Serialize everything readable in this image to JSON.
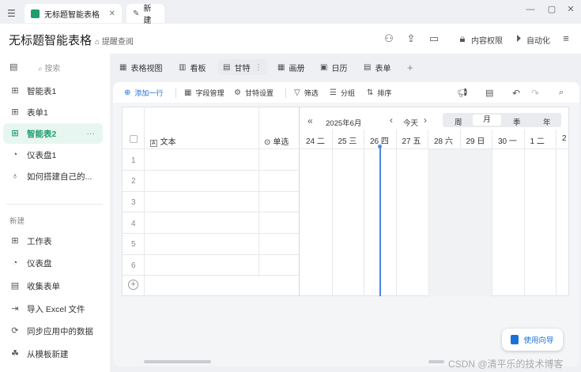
{
  "titlebar": {
    "tabs": [
      {
        "label": "无标题智能表格"
      },
      {
        "label": "新建"
      }
    ]
  },
  "header": {
    "title": "无标题智能表格",
    "remark": "提醒查阅",
    "permission": "内容权限",
    "automation": "自动化"
  },
  "sidebar": {
    "search_placeholder": "搜索",
    "items": [
      {
        "label": "智能表1",
        "icon": "grid-icon"
      },
      {
        "label": "表单1",
        "icon": "form-icon"
      },
      {
        "label": "智能表2",
        "icon": "grid-icon",
        "active": true
      },
      {
        "label": "仪表盘1",
        "icon": "dashboard-icon"
      },
      {
        "label": "如何搭建自己的...",
        "icon": "bulb-icon"
      }
    ],
    "new_section": "新建",
    "new_items": [
      {
        "label": "工作表"
      },
      {
        "label": "仪表盘"
      },
      {
        "label": "收集表单"
      },
      {
        "label": "导入 Excel 文件"
      },
      {
        "label": "同步应用中的数据"
      },
      {
        "label": "从模板新建"
      }
    ]
  },
  "views": {
    "tabs": [
      {
        "label": "表格视图"
      },
      {
        "label": "看板"
      },
      {
        "label": "甘特",
        "active": true
      },
      {
        "label": "画册"
      },
      {
        "label": "日历"
      },
      {
        "label": "表单"
      }
    ]
  },
  "toolbar": {
    "add_row": "添加一行",
    "field_manage": "字段管理",
    "gantt_settings": "甘特设置",
    "filter": "筛选",
    "group": "分组",
    "sort": "排序"
  },
  "grid": {
    "columns": [
      {
        "label": "文本"
      },
      {
        "label": "单选"
      }
    ],
    "rows": [
      "1",
      "2",
      "3",
      "4",
      "5",
      "6"
    ]
  },
  "gantt": {
    "month": "2025年6月",
    "today": "今天",
    "scales": [
      {
        "label": "周"
      },
      {
        "label": "月",
        "active": true
      },
      {
        "label": "季"
      },
      {
        "label": "年"
      }
    ],
    "days": [
      "24 二",
      "25 三",
      "26 四",
      "27 五",
      "28 六",
      "29 日",
      "30 一",
      "1 二",
      "2"
    ],
    "today_index": 2
  },
  "guide": {
    "label": "使用向导"
  },
  "watermark": "CSDN @清平乐的技术博客",
  "colors": {
    "accent": "#1f9d6c",
    "link": "#1a6fd9",
    "today_line": "#4a86e8"
  }
}
